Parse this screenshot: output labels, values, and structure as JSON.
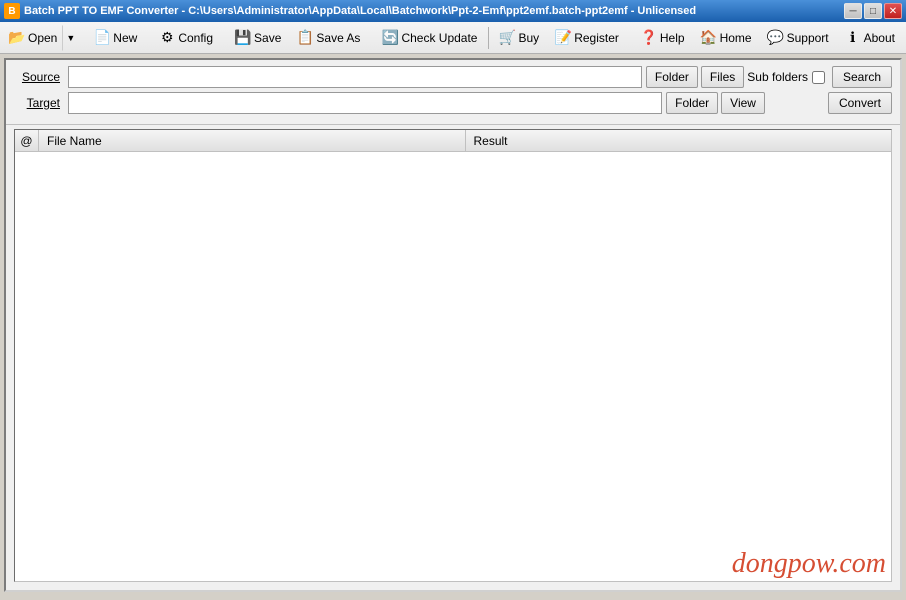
{
  "titlebar": {
    "icon_label": "B",
    "title": "Batch PPT TO EMF Converter - C:\\Users\\Administrator\\AppData\\Local\\Batchwork\\Ppt-2-Emf\\ppt2emf.batch-ppt2emf - Unlicensed",
    "minimize": "─",
    "maximize": "□",
    "close": "✕"
  },
  "toolbar": {
    "open_label": "Open",
    "new_label": "New",
    "config_label": "Config",
    "save_label": "Save",
    "saveas_label": "Save As",
    "checkupdate_label": "Check Update",
    "buy_label": "Buy",
    "register_label": "Register",
    "help_label": "Help",
    "home_label": "Home",
    "support_label": "Support",
    "about_label": "About"
  },
  "form": {
    "source_label": "Source",
    "source_underline": "S",
    "source_placeholder": "",
    "target_label": "Target",
    "target_underline": "T",
    "target_placeholder": "",
    "folder_btn": "Folder",
    "files_btn": "Files",
    "subfolders_label": "Sub folders",
    "search_btn": "Search",
    "view_btn": "View",
    "convert_btn": "Convert"
  },
  "table": {
    "col_at": "@",
    "col_filename": "File Name",
    "col_result": "Result",
    "rows": []
  },
  "watermark": {
    "text": "dongpow.com"
  },
  "icons": {
    "open": "📂",
    "new": "📄",
    "config": "⚙",
    "save": "💾",
    "saveas": "📋",
    "checkupdate": "🔄",
    "buy": "🛒",
    "register": "📝",
    "help": "❓",
    "home": "🏠",
    "support": "💬",
    "about": "ℹ",
    "arrow_down": "▼"
  }
}
